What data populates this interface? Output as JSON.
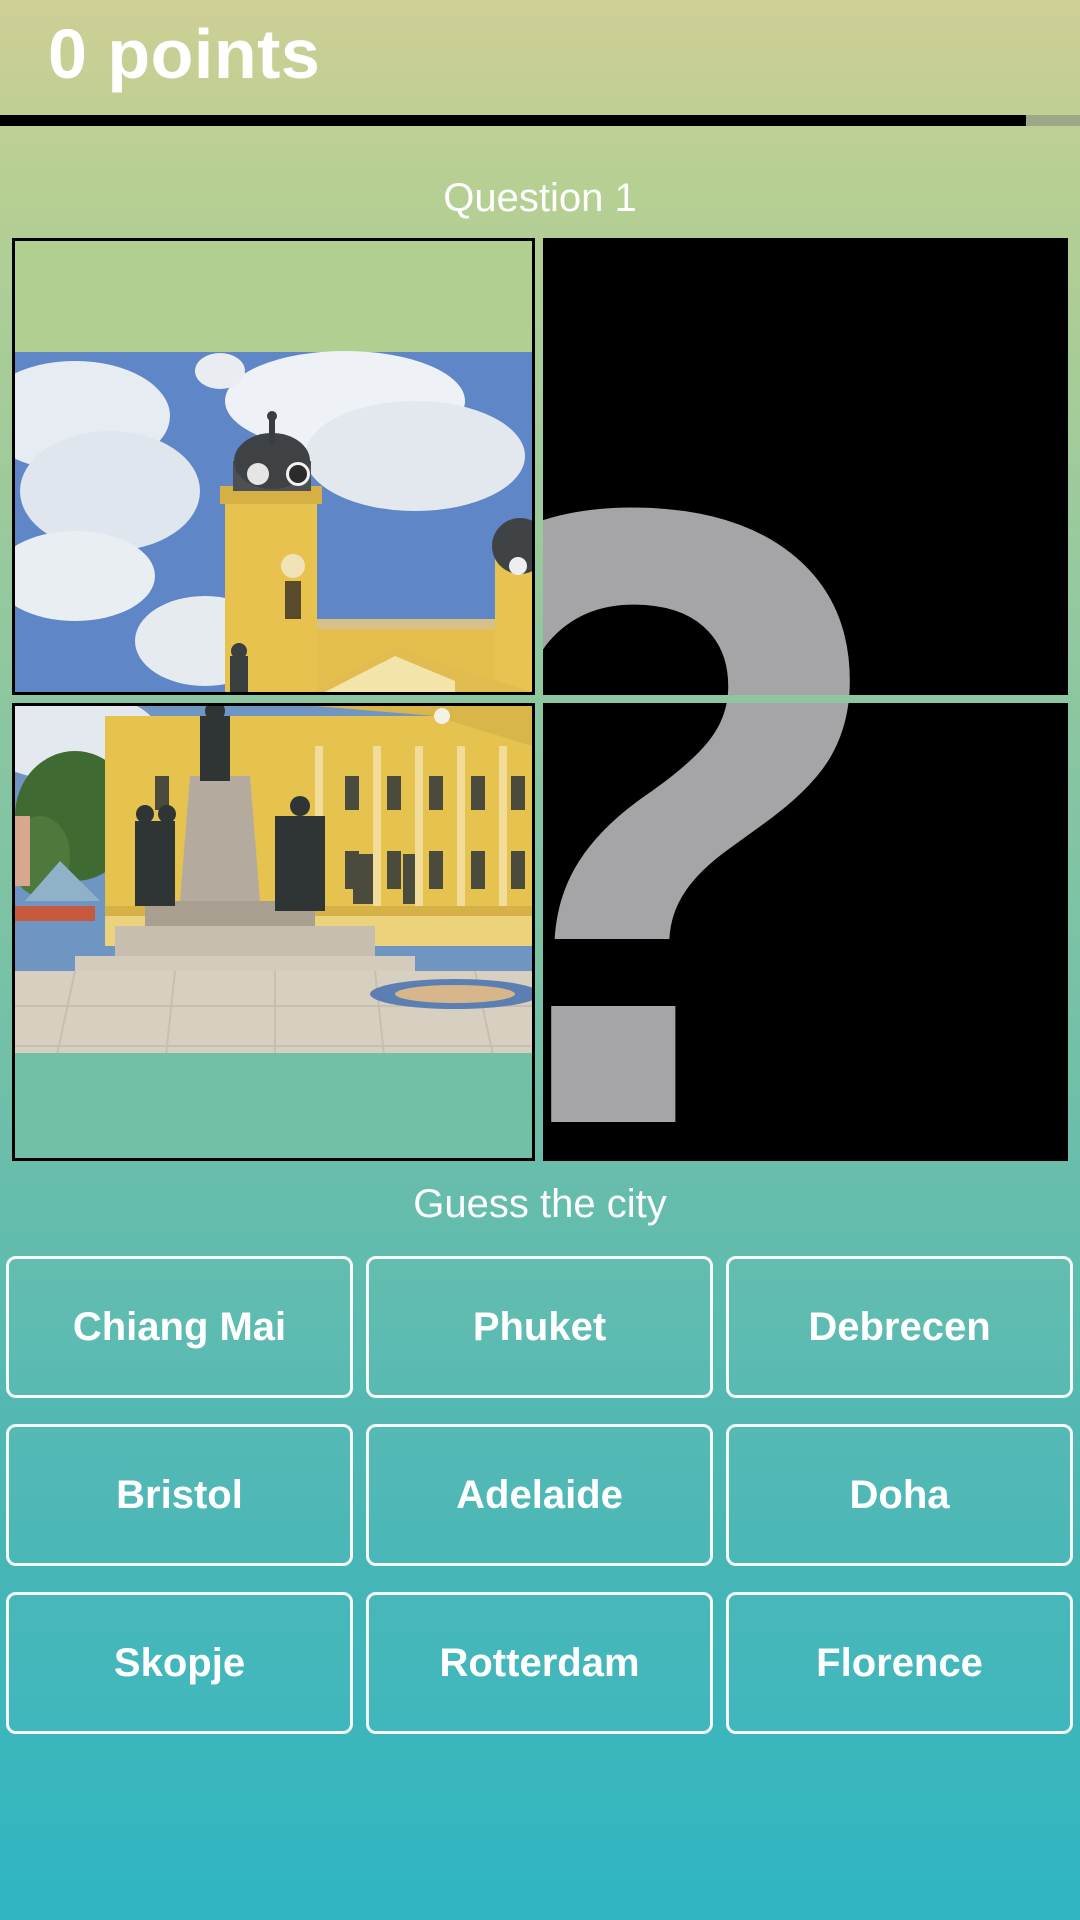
{
  "header": {
    "score": "0 points",
    "progress_fraction": 0.95
  },
  "question": {
    "title": "Question 1",
    "prompt": "Guess the city"
  },
  "puzzle": {
    "hidden_glyph": "?"
  },
  "answers": [
    "Chiang Mai",
    "Phuket",
    "Debrecen",
    "Bristol",
    "Adelaide",
    "Doha",
    "Skopje",
    "Rotterdam",
    "Florence"
  ],
  "colors": {
    "gradient_top": "#cfcf95",
    "gradient_bottom": "#2fb6c2",
    "progress_fill": "#000000",
    "hidden_tile": "#000000",
    "question_mark": "#a5a5a8"
  }
}
